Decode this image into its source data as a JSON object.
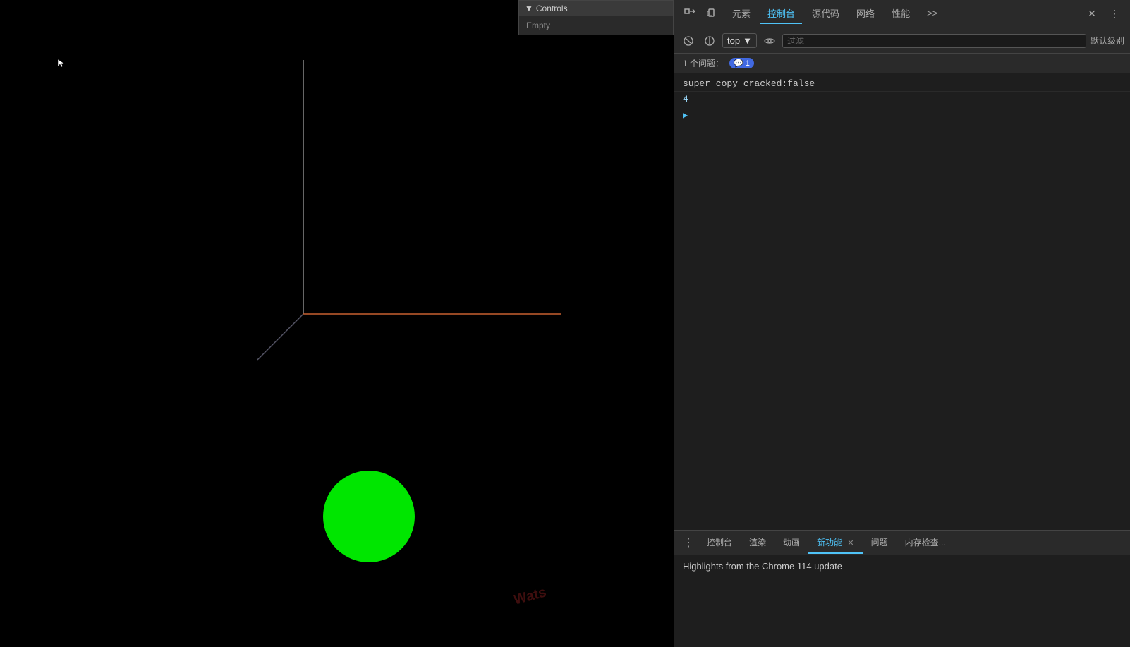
{
  "canvas": {
    "controls_label": "Controls",
    "controls_empty": "Empty",
    "watermark": "Wats"
  },
  "devtools": {
    "tabs": [
      {
        "label": "元素",
        "id": "elements",
        "active": false
      },
      {
        "label": "控制台",
        "id": "console",
        "active": true
      },
      {
        "label": "源代码",
        "id": "sources",
        "active": false
      },
      {
        "label": "网络",
        "id": "network",
        "active": false
      },
      {
        "label": "性能",
        "id": "perf",
        "active": false
      },
      {
        "label": ">>",
        "id": "more",
        "active": false
      }
    ],
    "toolbar2": {
      "top_label": "top",
      "filter_placeholder": "过滤",
      "default_level": "默认级别"
    },
    "issues": {
      "label": "1 个问题：",
      "badge_count": "1"
    },
    "console_lines": [
      {
        "text": "super_copy_cracked:false",
        "type": "text"
      },
      {
        "text": "4",
        "type": "value"
      }
    ],
    "bottom_tabs": [
      {
        "label": "控制台",
        "active": false,
        "closeable": false
      },
      {
        "label": "渲染",
        "active": false,
        "closeable": false
      },
      {
        "label": "动画",
        "active": false,
        "closeable": false
      },
      {
        "label": "新功能",
        "active": true,
        "closeable": true
      },
      {
        "label": "问题",
        "active": false,
        "closeable": false
      },
      {
        "label": "内存检查...",
        "active": false,
        "closeable": false
      }
    ],
    "bottom_content": {
      "text": "Highlights from the Chrome 114 update"
    }
  }
}
